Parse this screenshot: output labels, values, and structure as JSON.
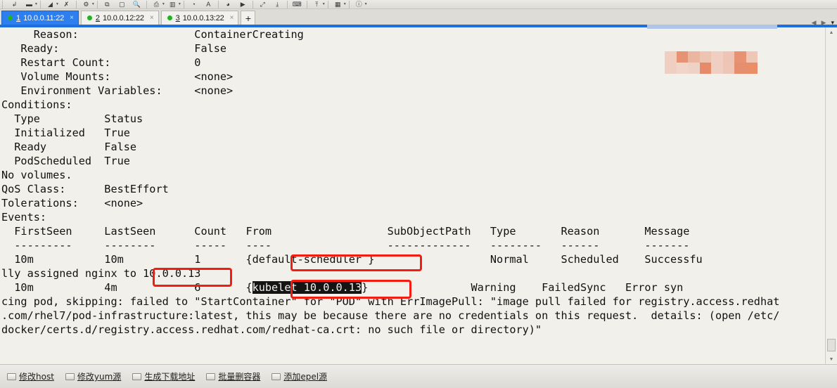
{
  "window": {
    "title": "SSH terminal - kubectl describe pod"
  },
  "toolbar": {
    "buttons": [
      {
        "name": "new-session-icon",
        "glyph": "↵"
      },
      {
        "name": "open-folder-icon",
        "glyph": "▬"
      },
      {
        "name": "transfer-icon",
        "glyph": "◢"
      },
      {
        "name": "disconnect-icon",
        "glyph": "✗"
      },
      {
        "name": "settings-gear-icon",
        "glyph": "⚙"
      },
      {
        "name": "copy-icon",
        "glyph": "⧉"
      },
      {
        "name": "paste-icon",
        "glyph": "▢"
      },
      {
        "name": "search-icon",
        "glyph": "⚲"
      },
      {
        "name": "print-icon",
        "glyph": "⎙"
      },
      {
        "name": "split-view-icon",
        "glyph": "▥"
      },
      {
        "name": "clock-icon",
        "glyph": "◔"
      },
      {
        "name": "font-icon",
        "glyph": "A"
      },
      {
        "name": "color-icon",
        "glyph": "◕"
      },
      {
        "name": "flag-icon",
        "glyph": "▶"
      },
      {
        "name": "fullscreen-icon",
        "glyph": "⤢"
      },
      {
        "name": "upload-icon",
        "glyph": "⤓"
      },
      {
        "name": "keyboard-icon",
        "glyph": "⌨"
      },
      {
        "name": "download-icon",
        "glyph": "⤒"
      },
      {
        "name": "layout-icon",
        "glyph": "▦"
      },
      {
        "name": "info-icon",
        "glyph": "ⓘ"
      }
    ]
  },
  "tabs": {
    "items": [
      {
        "num": "1",
        "label": "10.0.0.11:22",
        "active": true,
        "close": "×",
        "status_color": "#22b222"
      },
      {
        "num": "2",
        "label": "10.0.0.12:22",
        "active": false,
        "close": "×",
        "status_color": "#22b222"
      },
      {
        "num": "3",
        "label": "10.0.0.13:22",
        "active": false,
        "close": "×",
        "status_color": "#22b222"
      }
    ],
    "add_label": "+",
    "nav_prev": "◀",
    "nav_next": "▶",
    "nav_menu": "▾"
  },
  "terminal": {
    "lines": [
      "     Reason:                  ContainerCreating",
      "   Ready:                     False",
      "   Restart Count:             0",
      "   Volume Mounts:             <none>",
      "   Environment Variables:     <none>",
      "Conditions:",
      "  Type          Status",
      "  Initialized   True",
      "  Ready         False",
      "  PodScheduled  True",
      "No volumes.",
      "QoS Class:      BestEffort",
      "Tolerations:    <none>",
      "Events:",
      "  FirstSeen     LastSeen      Count   From                  SubObjectPath   Type       Reason       Message",
      "  ---------     --------      -----   ----                  -------------   --------   ------       -------",
      "  10m           10m           1       {default-scheduler }                  Normal     Scheduled    Successfu"
    ],
    "line_assigned": "lly assigned nginx to 10.0.0.13",
    "line_event2_pre": "  10m           4m            6       {",
    "line_event2_sel": "kubelet 10.0.0.13",
    "line_event2_post": "}                Warning    FailedSync   Error syn",
    "line_wrap1": "cing pod, skipping: failed to \"StartContainer\" for \"POD\" with ErrImagePull: \"image pull failed for registry.access.redhat",
    "line_wrap2": ".com/rhel7/pod-infrastructure:latest, this may be because there are no credentials on this request.  details: (open /etc/",
    "line_wrap3": "docker/certs.d/registry.access.redhat.com/redhat-ca.crt: no such file or directory)\"",
    "colors": {
      "background": "#f1f0eb",
      "foreground": "#111111",
      "selection_background": "#141414",
      "selection_foreground": "#f2f1ec",
      "annotation_red": "#f41c10",
      "scrollbar_blue": "#1d6fe0"
    }
  },
  "annotations": [
    {
      "name": "highlight-default-scheduler",
      "target": "{default-scheduler }"
    },
    {
      "name": "highlight-node-ip",
      "target": "10.0.0.13"
    },
    {
      "name": "highlight-kubelet",
      "target": "{kubelet 10.0.0.13}"
    }
  ],
  "statusbar": {
    "items": [
      {
        "icon": "script-icon",
        "label": "修改host"
      },
      {
        "icon": "script-icon",
        "label": "修改yum源"
      },
      {
        "icon": "script-icon",
        "label": "生成下载地址"
      },
      {
        "icon": "script-icon",
        "label": "批量删容器"
      },
      {
        "icon": "script-icon",
        "label": "添加epel源"
      }
    ]
  }
}
